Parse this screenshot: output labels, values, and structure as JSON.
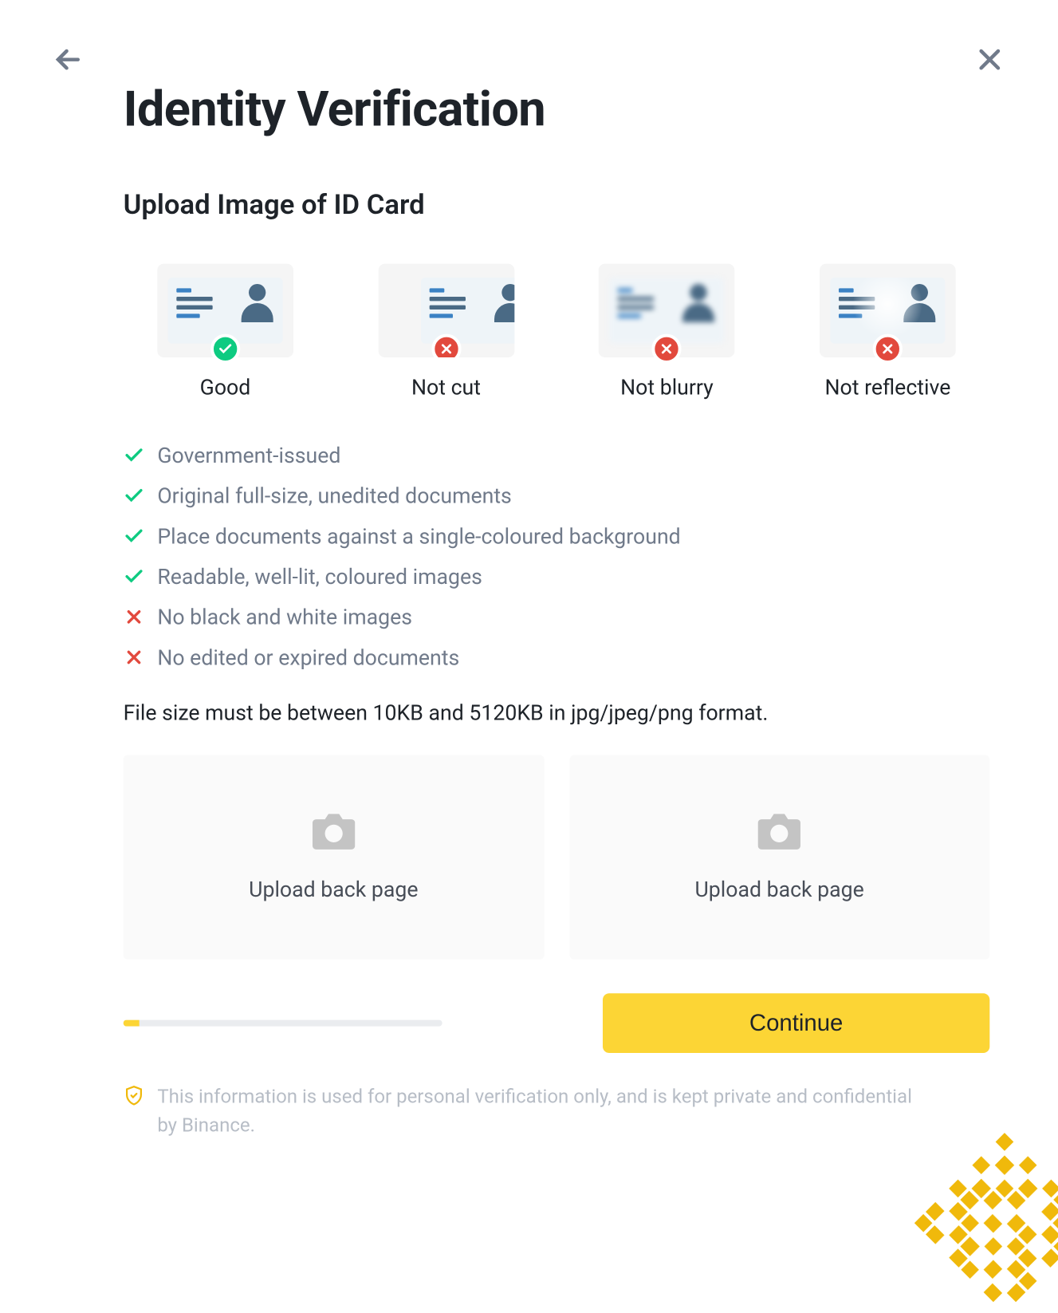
{
  "title": "Identity Verification",
  "subtitle": "Upload Image of ID Card",
  "examples": {
    "good": "Good",
    "not_cut": "Not cut",
    "not_blurry": "Not blurry",
    "not_reflective": "Not reflective"
  },
  "rules": {
    "r0": "Government-issued",
    "r1": "Original full-size, unedited documents",
    "r2": "Place documents against a single-coloured background",
    "r3": "Readable, well-lit, coloured images",
    "r4": "No black and white images",
    "r5": "No edited or expired documents"
  },
  "file_note": "File size must be between 10KB and 5120KB in jpg/jpeg/png format.",
  "upload": {
    "left_label": "Upload back page",
    "right_label": "Upload back page"
  },
  "continue_label": "Continue",
  "privacy_text": "This information is used for personal verification only, and is kept private and confidential by Binance.",
  "progress_percent": 5
}
